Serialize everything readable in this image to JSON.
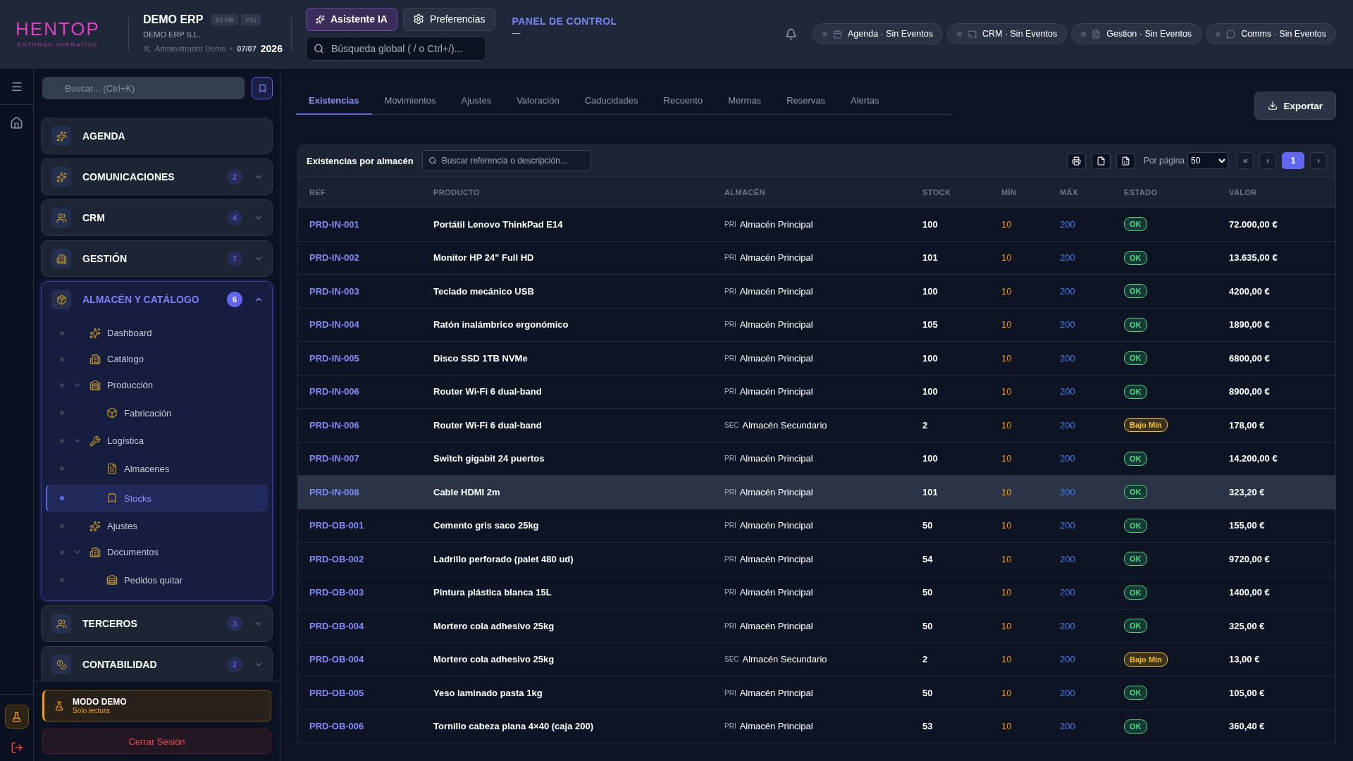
{
  "header": {
    "logo": "HENTOP",
    "logo_tagline": "ENTORNO OPERATIVO",
    "company": "DEMO ERP",
    "badges": [
      "63 MB",
      "V31"
    ],
    "company_legal": "DEMO ERP S.L.",
    "user": "Administrador Demo",
    "date": "07/07",
    "year": "2026",
    "assistant_button": "Asistente IA",
    "preferences_button": "Preferencias",
    "search": {
      "placeholder": "Búsqueda global ( / o Ctrl+/)..."
    },
    "page_title": "PANEL DE CONTROL",
    "page_subtitle": "—",
    "chips": [
      {
        "label": "Agenda · Sin Eventos",
        "kind": "calendar"
      },
      {
        "label": "CRM · Sin Eventos",
        "kind": "cast"
      },
      {
        "label": "Gestion · Sin Eventos",
        "kind": "file"
      },
      {
        "label": "Comms · Sin Eventos",
        "kind": "chat"
      }
    ]
  },
  "sidebar": {
    "search": {
      "placeholder": "Buscar... (Ctrl+K)"
    },
    "groups": [
      {
        "label": "AGENDA",
        "expanded": false
      },
      {
        "label": "COMUNICACIONES",
        "count": "2",
        "expanded": false
      },
      {
        "label": "CRM",
        "count": "4",
        "expanded": false
      },
      {
        "label": "GESTIÓN",
        "count": "7",
        "expanded": false
      },
      {
        "label": "ALMACÉN Y CATÁLOGO",
        "count": "6",
        "expanded": true,
        "children": [
          {
            "label": "Dashboard",
            "selected": false
          },
          {
            "label": "Catálogo",
            "selected": false
          },
          {
            "label": "Producción",
            "selected": false,
            "expanded": true,
            "children": [
              {
                "label": "Fabricación",
                "selected": false
              }
            ]
          },
          {
            "label": "Logística",
            "selected": false,
            "expanded": true,
            "children": [
              {
                "label": "Almacenes",
                "selected": false
              },
              {
                "label": "Stocks",
                "selected": true
              }
            ]
          },
          {
            "label": "Ajustes",
            "selected": false
          },
          {
            "label": "Documentos",
            "selected": false,
            "expanded": true,
            "children": [
              {
                "label": "Pedidos quitar",
                "selected": false
              }
            ]
          }
        ]
      },
      {
        "label": "TERCEROS",
        "count": "3",
        "expanded": false
      },
      {
        "label": "CONTABILIDAD",
        "count": "2",
        "expanded": false
      }
    ],
    "demo": {
      "title": "MODO DEMO",
      "subtitle": "Solo lectura"
    },
    "logout": "Cerrar Sesión"
  },
  "tabs": [
    {
      "label": "Existencias",
      "selected": true
    },
    {
      "label": "Movimientos",
      "selected": false
    },
    {
      "label": "Ajustes",
      "selected": false
    },
    {
      "label": "Valoración",
      "selected": false
    },
    {
      "label": "Caducidades",
      "selected": false
    },
    {
      "label": "Recuento",
      "selected": false
    },
    {
      "label": "Mermas",
      "selected": false
    },
    {
      "label": "Reservas",
      "selected": false
    },
    {
      "label": "Alertas",
      "selected": false
    }
  ],
  "export_button": "Exportar",
  "table": {
    "title": "Existencias por almacén",
    "search": {
      "placeholder": "Buscar referencia o descripción..."
    },
    "per_page_label": "Por página",
    "per_page": "50",
    "pages": [
      {
        "label": "«",
        "selected": false
      },
      {
        "label": "‹",
        "selected": false
      },
      {
        "label": "1",
        "selected": true
      },
      {
        "label": "›",
        "selected": false
      }
    ],
    "columns": [
      "REF",
      "PRODUCTO",
      "ALMACÉN",
      "STOCK",
      "MÍN",
      "MÁX",
      "ESTADO",
      "VALOR"
    ],
    "rows": [
      {
        "ref": "PRD-IN-001",
        "product": "Portátil Lenovo ThinkPad E14",
        "wh_code": "PRI",
        "warehouse": "Almacén Principal",
        "stock": "100",
        "min": "10",
        "max": "200",
        "status": "OK",
        "color": "#4ade80",
        "value": "72.000,00 €",
        "selected": false
      },
      {
        "ref": "PRD-IN-002",
        "product": "Monitor HP 24\" Full HD",
        "wh_code": "PRI",
        "warehouse": "Almacén Principal",
        "stock": "101",
        "min": "10",
        "max": "200",
        "status": "OK",
        "color": "#4ade80",
        "value": "13.635,00 €",
        "selected": false
      },
      {
        "ref": "PRD-IN-003",
        "product": "Teclado mecánico USB",
        "wh_code": "PRI",
        "warehouse": "Almacén Principal",
        "stock": "100",
        "min": "10",
        "max": "200",
        "status": "OK",
        "color": "#4ade80",
        "value": "4200,00 €",
        "selected": false
      },
      {
        "ref": "PRD-IN-004",
        "product": "Ratón inalámbrico ergonómico",
        "wh_code": "PRI",
        "warehouse": "Almacén Principal",
        "stock": "105",
        "min": "10",
        "max": "200",
        "status": "OK",
        "color": "#4ade80",
        "value": "1890,00 €",
        "selected": false
      },
      {
        "ref": "PRD-IN-005",
        "product": "Disco SSD 1TB NVMe",
        "wh_code": "PRI",
        "warehouse": "Almacén Principal",
        "stock": "100",
        "min": "10",
        "max": "200",
        "status": "OK",
        "color": "#4ade80",
        "value": "6800,00 €",
        "selected": false
      },
      {
        "ref": "PRD-IN-006",
        "product": "Router Wi-Fi 6 dual-band",
        "wh_code": "PRI",
        "warehouse": "Almacén Principal",
        "stock": "100",
        "min": "10",
        "max": "200",
        "status": "OK",
        "color": "#4ade80",
        "value": "8900,00 €",
        "selected": false
      },
      {
        "ref": "PRD-IN-006",
        "product": "Router Wi-Fi 6 dual-band",
        "wh_code": "SEC",
        "warehouse": "Almacén Secundario",
        "stock": "2",
        "min": "10",
        "max": "200",
        "status": "Bajo Mín",
        "color": "#fbbf24",
        "value": "178,00 €",
        "selected": false
      },
      {
        "ref": "PRD-IN-007",
        "product": "Switch gigabit 24 puertos",
        "wh_code": "PRI",
        "warehouse": "Almacén Principal",
        "stock": "100",
        "min": "10",
        "max": "200",
        "status": "OK",
        "color": "#4ade80",
        "value": "14.200,00 €",
        "selected": false
      },
      {
        "ref": "PRD-IN-008",
        "product": "Cable HDMI 2m",
        "wh_code": "PRI",
        "warehouse": "Almacén Principal",
        "stock": "101",
        "min": "10",
        "max": "200",
        "status": "OK",
        "color": "#4ade80",
        "value": "323,20 €",
        "selected": true
      },
      {
        "ref": "PRD-OB-001",
        "product": "Cemento gris saco 25kg",
        "wh_code": "PRI",
        "warehouse": "Almacén Principal",
        "stock": "50",
        "min": "10",
        "max": "200",
        "status": "OK",
        "color": "#4ade80",
        "value": "155,00 €",
        "selected": false
      },
      {
        "ref": "PRD-OB-002",
        "product": "Ladrillo perforado (palet 480 ud)",
        "wh_code": "PRI",
        "warehouse": "Almacén Principal",
        "stock": "54",
        "min": "10",
        "max": "200",
        "status": "OK",
        "color": "#4ade80",
        "value": "9720,00 €",
        "selected": false
      },
      {
        "ref": "PRD-OB-003",
        "product": "Pintura plástica blanca 15L",
        "wh_code": "PRI",
        "warehouse": "Almacén Principal",
        "stock": "50",
        "min": "10",
        "max": "200",
        "status": "OK",
        "color": "#4ade80",
        "value": "1400,00 €",
        "selected": false
      },
      {
        "ref": "PRD-OB-004",
        "product": "Mortero cola adhesivo 25kg",
        "wh_code": "PRI",
        "warehouse": "Almacén Principal",
        "stock": "50",
        "min": "10",
        "max": "200",
        "status": "OK",
        "color": "#4ade80",
        "value": "325,00 €",
        "selected": false
      },
      {
        "ref": "PRD-OB-004",
        "product": "Mortero cola adhesivo 25kg",
        "wh_code": "SEC",
        "warehouse": "Almacén Secundario",
        "stock": "2",
        "min": "10",
        "max": "200",
        "status": "Bajo Mín",
        "color": "#fbbf24",
        "value": "13,00 €",
        "selected": false
      },
      {
        "ref": "PRD-OB-005",
        "product": "Yeso laminado pasta 1kg",
        "wh_code": "PRI",
        "warehouse": "Almacén Principal",
        "stock": "50",
        "min": "10",
        "max": "200",
        "status": "OK",
        "color": "#4ade80",
        "value": "105,00 €",
        "selected": false
      },
      {
        "ref": "PRD-OB-006",
        "product": "Tornillo cabeza plana 4×40 (caja 200)",
        "wh_code": "PRI",
        "warehouse": "Almacén Principal",
        "stock": "53",
        "min": "10",
        "max": "200",
        "status": "OK",
        "color": "#4ade80",
        "value": "360,40 €",
        "selected": false
      }
    ]
  }
}
